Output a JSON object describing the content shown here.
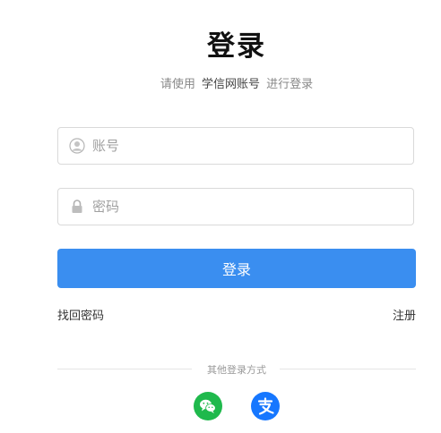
{
  "header": {
    "title": "登录",
    "subtitle_prefix": "请使用",
    "subtitle_account": "学信网账号",
    "subtitle_suffix": "进行登录"
  },
  "form": {
    "username_placeholder": "账号",
    "password_placeholder": "密码",
    "login_button": "登录",
    "username_icon": "user-icon",
    "password_icon": "lock-icon"
  },
  "links": {
    "forgot_password": "找回密码",
    "register": "注册"
  },
  "social_login": {
    "label": "其他登录方式",
    "options": [
      {
        "name": "wechat",
        "icon": "wechat-icon",
        "color": "#1fb94c"
      },
      {
        "name": "alipay",
        "icon": "alipay-icon",
        "color": "#1677ff"
      }
    ]
  },
  "colors": {
    "primary": "#3a8ef0",
    "title": "#111111"
  }
}
